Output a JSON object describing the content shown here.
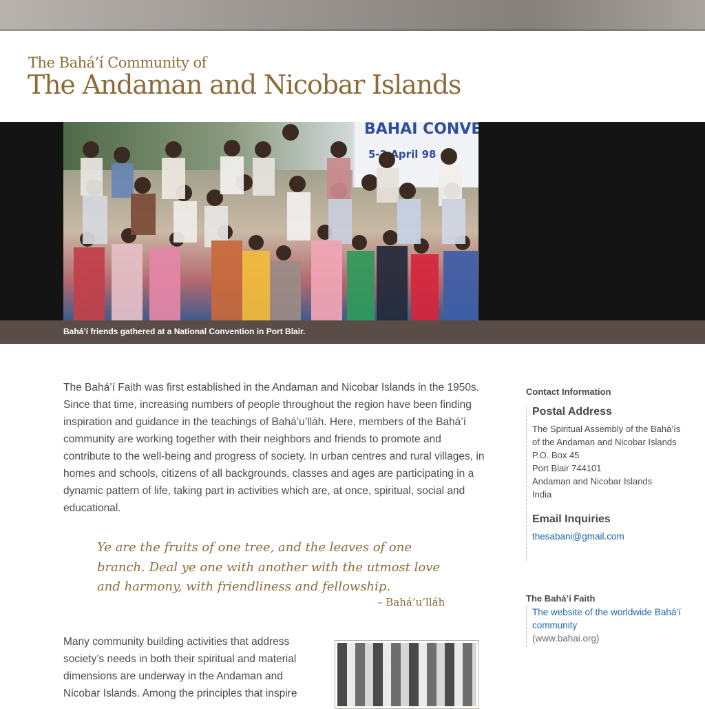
{
  "header": {
    "subtitle": "The Bahá’í Community of",
    "title": "The Andaman and Nicobar Islands"
  },
  "hero": {
    "sign_text": "BAHAI CONVEN",
    "sign_dates": "5-2 April 98",
    "caption": "Bahá’í friends gathered at a National Convention in Port Blair."
  },
  "main": {
    "paragraph1": "The Bahá’í Faith was first established in the Andaman and Nicobar Islands in the 1950s. Since that time, increasing numbers of people throughout the region have been finding inspiration and guidance in the teachings of Bahá’u’lláh. Here, members of the Bahá’í community are working together with their neighbors and friends to promote and contribute to the well-being and progress of society. In urban centres and rural villages, in homes and schools, citizens of all backgrounds, classes and ages are participating in a dynamic pattern of life, taking part in activities which are, at once, spiritual, social and educational.",
    "quote": "Ye are the fruits of one tree, and the leaves of one branch. Deal ye one with another with the utmost love and harmony, with friendliness and fellowship.",
    "quote_attribution": "– Bahá’u’lláh",
    "paragraph2": "Many community building activities that address society’s needs in both their spiritual and material dimensions are underway in the Andaman and Nicobar Islands. Among the principles that inspire"
  },
  "sidebar": {
    "contact_heading": "Contact Information",
    "postal_heading": "Postal Address",
    "address_lines": [
      "The Spiritual Assembly of the Bahá’ís",
      "of the Andaman and Nicobar Islands",
      "P.O. Box 45",
      "Port Blair 744101",
      "Andaman and Nicobar Islands",
      "India"
    ],
    "email_heading": "Email Inquiries",
    "email": "thesabani@gmail.com",
    "faith_heading": "The Bahá’í Faith",
    "faith_link": "The website of the worldwide Bahá’í community",
    "faith_url_text": "(www.bahai.org)"
  },
  "colors": {
    "title": "#8c6b37",
    "caption_bar": "#5a4d47",
    "link": "#1d64a8"
  }
}
